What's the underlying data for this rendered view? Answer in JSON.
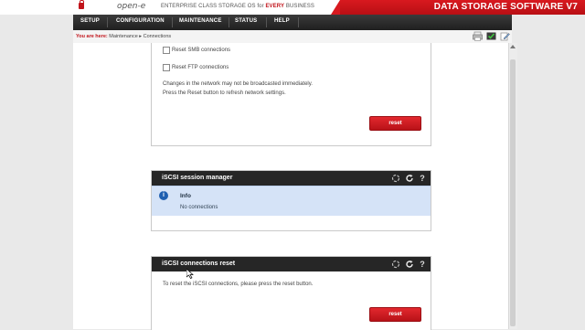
{
  "header": {
    "logo": "open-e",
    "tagline_prefix": "ENTERPRISE CLASS STORAGE OS for ",
    "tagline_emphasis": "EVERY",
    "tagline_suffix": " BUSINESS",
    "brand": "DATA STORAGE SOFTWARE V7",
    "accent_color": "#c1141b"
  },
  "nav": {
    "items": [
      {
        "label": "SETUP"
      },
      {
        "label": "CONFIGURATION"
      },
      {
        "label": "MAINTENANCE"
      },
      {
        "label": "STATUS"
      },
      {
        "label": "HELP"
      }
    ]
  },
  "breadcrumb": {
    "prefix": "You are here:",
    "path": "Maintenance ▸ Connections"
  },
  "panel_network_reset": {
    "options": [
      {
        "label": "Reset SMB connections",
        "checked": false
      },
      {
        "label": "Reset FTP connections",
        "checked": false
      }
    ],
    "note_line1": "Changes in the network may not be broadcasted immediately.",
    "note_line2": "Press the Reset button to refresh network settings.",
    "button_label": "reset"
  },
  "panel_iscsi_session": {
    "title": "iSCSI session manager",
    "info_title": "Info",
    "info_message": "No connections",
    "icons": [
      "spinner-icon",
      "refresh-icon",
      "help-icon"
    ]
  },
  "panel_iscsi_reset": {
    "title": "iSCSI connections reset",
    "description": "To reset the iSCSI connections, please press the reset button.",
    "button_label": "reset"
  }
}
